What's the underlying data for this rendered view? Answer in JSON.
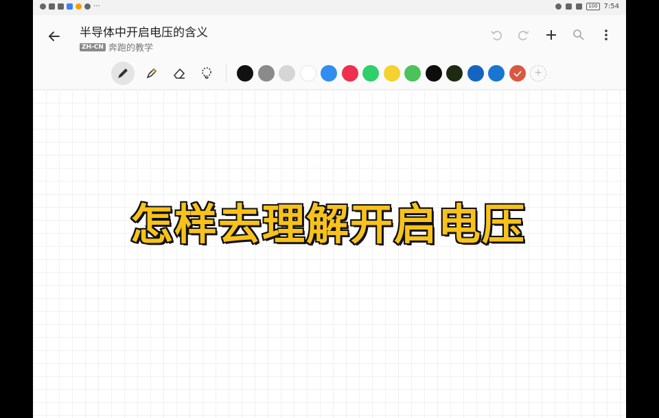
{
  "status_bar": {
    "time": "7:54",
    "battery": "100"
  },
  "header": {
    "title": "半导体中开启电压的含义",
    "lang_badge": "ZH-CN",
    "subtitle": "奔跑的教学"
  },
  "toolbar": {
    "colors": [
      "#111111",
      "#8a8a8a",
      "#d6d6d6",
      "#ffffff",
      "#2f8ef0",
      "#ef2f4f",
      "#2fd06a",
      "#f5d22e",
      "#4cc25a",
      "#0d0d0d",
      "#1f2a12",
      "#1565c0",
      "#1876d2",
      "#d9583f"
    ],
    "add_label": "+"
  },
  "canvas": {
    "text": "怎样去理解开启电压"
  }
}
